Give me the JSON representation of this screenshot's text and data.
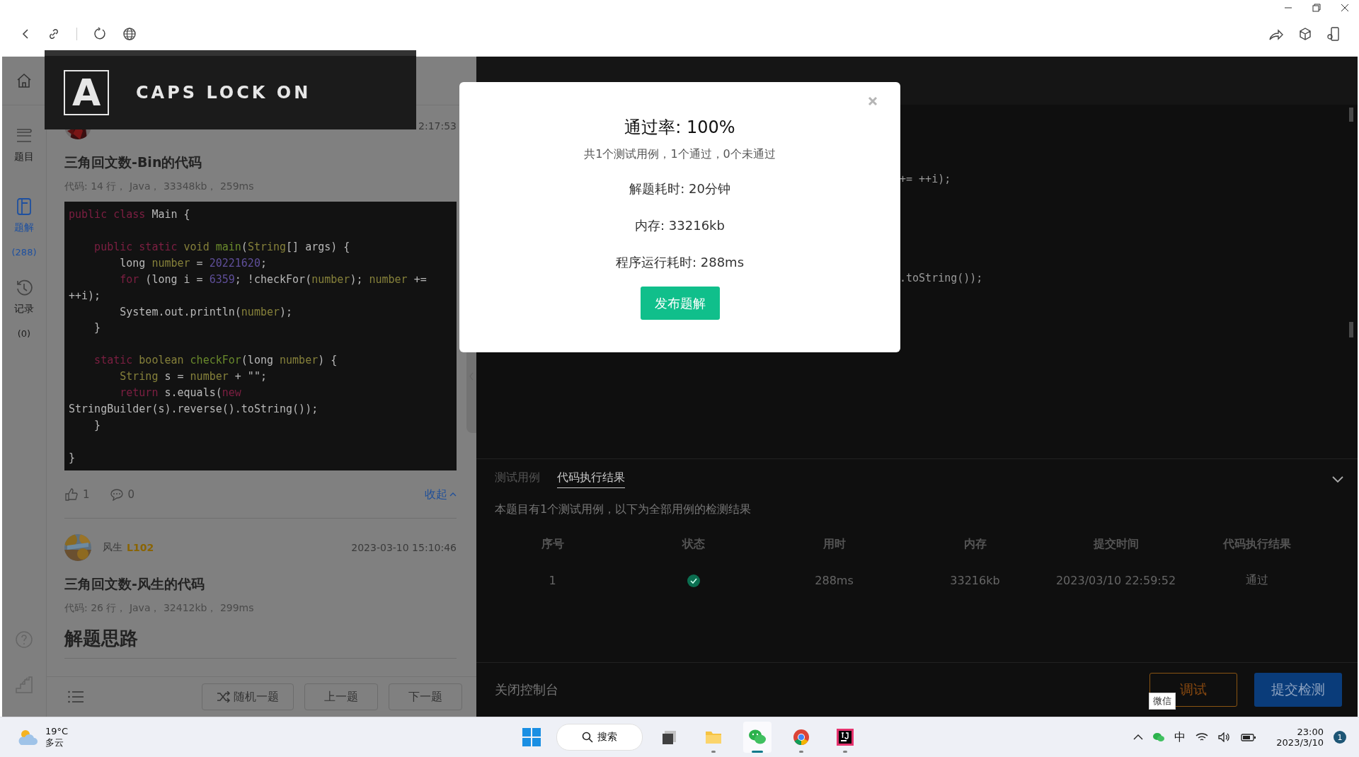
{
  "sidebar": {
    "items": [
      {
        "kind": "home",
        "selected": false
      },
      {
        "kind": "problem",
        "label": "题目",
        "selected": false
      },
      {
        "kind": "solution",
        "label": "题解",
        "count": "(288)",
        "selected": true
      },
      {
        "kind": "record",
        "label": "记录",
        "count": "(0)",
        "selected": false
      }
    ],
    "bottom_icons": [
      {
        "kind": "help"
      },
      {
        "kind": "ranking"
      }
    ]
  },
  "posts": [
    {
      "date": "2:17:53",
      "title": "三角回文数-Bin的代码",
      "meta": "代码: 14 行， Java， 33348kb， 259ms",
      "code": [
        {
          "tokens": [
            {
              "kind": "kw",
              "text": "public class"
            },
            {
              "kind": "plain",
              "text": " Main {"
            }
          ]
        },
        {
          "space_before": true,
          "tokens": [
            {
              "kind": "kw",
              "text": "    public static"
            },
            {
              "kind": "type",
              "text": " void"
            },
            {
              "kind": "fn",
              "text": " main"
            },
            {
              "kind": "plain",
              "text": "("
            },
            {
              "kind": "type",
              "text": "String"
            },
            {
              "kind": "plain",
              "text": "[] args) {"
            }
          ]
        },
        {
          "tokens": [
            {
              "kind": "plain",
              "text": "        long "
            },
            {
              "kind": "type",
              "text": "number"
            },
            {
              "kind": "plain",
              "text": " = "
            },
            {
              "kind": "num",
              "text": "20221620"
            },
            {
              "kind": "plain",
              "text": ";"
            }
          ]
        },
        {
          "tokens": [
            {
              "kind": "kw",
              "text": "        for"
            },
            {
              "kind": "plain",
              "text": " (long i = "
            },
            {
              "kind": "num",
              "text": "6359"
            },
            {
              "kind": "plain",
              "text": "; !checkFor("
            },
            {
              "kind": "type",
              "text": "number"
            },
            {
              "kind": "plain",
              "text": "); "
            },
            {
              "kind": "type",
              "text": "number"
            },
            {
              "kind": "plain",
              "text": " +="
            }
          ]
        },
        {
          "tokens": [
            {
              "kind": "plain",
              "text": "++i);"
            }
          ]
        },
        {
          "tokens": [
            {
              "kind": "plain",
              "text": "        System.out.println("
            },
            {
              "kind": "type",
              "text": "number"
            },
            {
              "kind": "plain",
              "text": ");"
            }
          ]
        },
        {
          "tokens": [
            {
              "kind": "plain",
              "text": "    }"
            }
          ]
        },
        {
          "space_before": true,
          "tokens": [
            {
              "kind": "kw",
              "text": "    static"
            },
            {
              "kind": "type",
              "text": " boolean"
            },
            {
              "kind": "fn",
              "text": " checkFor"
            },
            {
              "kind": "plain",
              "text": "(long "
            },
            {
              "kind": "type",
              "text": "number"
            },
            {
              "kind": "plain",
              "text": ") {"
            }
          ]
        },
        {
          "tokens": [
            {
              "kind": "type",
              "text": "        String"
            },
            {
              "kind": "plain",
              "text": " s = "
            },
            {
              "kind": "type",
              "text": "number"
            },
            {
              "kind": "plain",
              "text": " + \"\";"
            }
          ]
        },
        {
          "tokens": [
            {
              "kind": "kw",
              "text": "        return"
            },
            {
              "kind": "plain",
              "text": " s.equals("
            },
            {
              "kind": "kw",
              "text": "new"
            }
          ]
        },
        {
          "tokens": [
            {
              "kind": "plain",
              "text": "StringBuilder(s).reverse().toString());"
            }
          ]
        },
        {
          "tokens": [
            {
              "kind": "plain",
              "text": "    }"
            }
          ]
        },
        {
          "space_before": true,
          "tokens": [
            {
              "kind": "plain",
              "text": "}"
            }
          ]
        }
      ],
      "likes": "1",
      "comments": "0",
      "collapse": "收起"
    },
    {
      "author": "风生",
      "level": "L102",
      "date": "2023-03-10 15:10:46",
      "title": "三角回文数-风生的代码",
      "meta": "代码: 26 行， Java， 32412kb， 299ms",
      "heading": "解题思路"
    }
  ],
  "footer_buttons": [
    "随机一题",
    "上一题",
    "下一题"
  ],
  "editor_fragments": [
    "+= ++i);",
    ".toString());"
  ],
  "console": {
    "tabs": [
      {
        "label": "测试用例",
        "selected": false
      },
      {
        "label": "代码执行结果",
        "selected": true
      }
    ],
    "info": "本题目有1个测试用例，以下为全部用例的检测结果",
    "columns": [
      "序号",
      "状态",
      "用时",
      "内存",
      "提交时间",
      "代码执行结果"
    ],
    "rows": [
      {
        "index": "1",
        "kind": "passed",
        "time": "288ms",
        "memory": "33216kb",
        "submitted": "2023/03/10 22:59:52",
        "result": "通过"
      }
    ],
    "close_label": "关闭控制台",
    "debug_button": "调试",
    "submit_button": "提交检测"
  },
  "modal": {
    "title": "通过率: 100%",
    "summary": "共1个测试用例，1个通过，0个未通过",
    "lines": [
      "解题耗时: 20分钟",
      "内存: 33216kb",
      "程序运行耗时: 288ms"
    ],
    "button": "发布题解"
  },
  "caps_osd": {
    "key": "A",
    "text": "CAPS LOCK ON"
  },
  "tooltip": "微信",
  "taskbar": {
    "weather": {
      "temp": "19°C",
      "condition": "多云"
    },
    "search": "搜索",
    "apps": [
      {
        "kind": "taskview",
        "running": false,
        "active": false
      },
      {
        "kind": "files",
        "running": true,
        "active": false
      },
      {
        "kind": "chat",
        "running": true,
        "active": true
      },
      {
        "kind": "browser",
        "running": true,
        "active": false
      },
      {
        "kind": "ide",
        "running": true,
        "active": false
      }
    ],
    "ime": "中",
    "time": "23:00",
    "date": "2023/3/10",
    "notifications": "1"
  }
}
